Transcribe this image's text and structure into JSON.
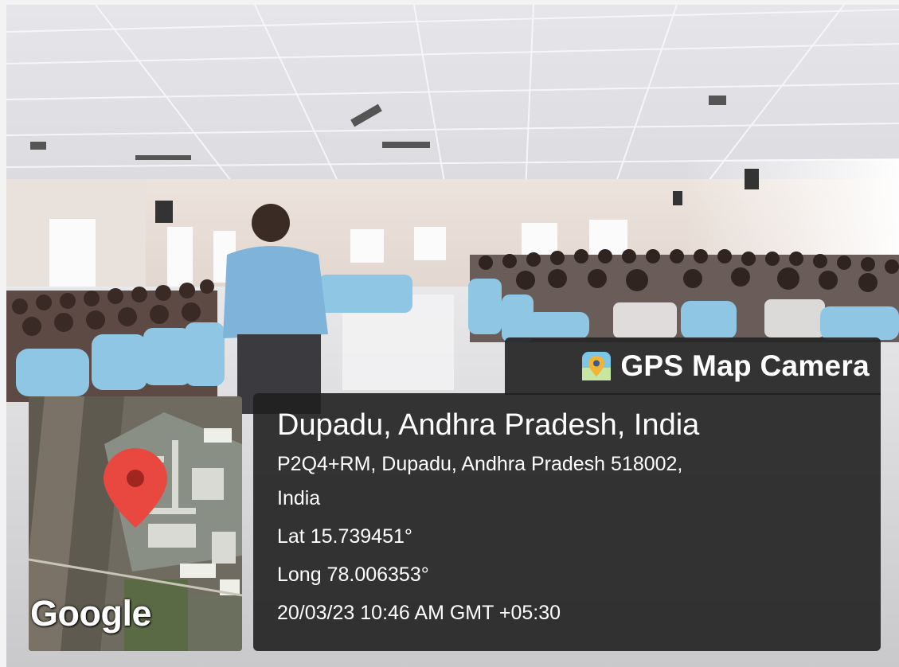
{
  "badge": {
    "app_name": "GPS Map Camera",
    "icon": "location-pin-map-icon"
  },
  "location": {
    "place": "Dupadu, Andhra Pradesh, India",
    "address_line1": "P2Q4+RM, Dupadu, Andhra Pradesh 518002,",
    "address_line2": "India",
    "lat": "Lat 15.739451°",
    "long": "Long 78.006353°",
    "datetime": "20/03/23 10:46 AM GMT +05:30"
  },
  "map": {
    "attribution": "Google",
    "marker_color": "#e8483f"
  },
  "scene": {
    "description_icons": [
      "presenter",
      "audience",
      "plastic-chairs",
      "ceiling-fans",
      "speakers",
      "windows"
    ],
    "chair_color": "#8fc6e4",
    "shirt_color": "#7fb3d9"
  }
}
